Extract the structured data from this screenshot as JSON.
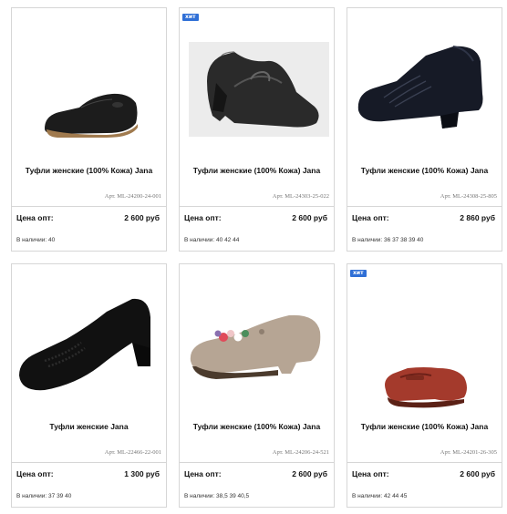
{
  "products": [
    {
      "badge": "",
      "name": "Туфли женские (100% Кожа) Jana",
      "sku": "Арт. ML-24200-24-001",
      "price_label": "Цена опт:",
      "price": "2 600 руб",
      "availability": "В наличии: 40",
      "image": "black-leather-loafer-icon"
    },
    {
      "badge": "хит",
      "name": "Туфли женские (100% Кожа) Jana",
      "sku": "Арт. ML-24303-25-022",
      "price_label": "Цена опт:",
      "price": "2 600 руб",
      "availability": "В наличии: 40 42 44",
      "image": "black-mary-jane-shoe-icon"
    },
    {
      "badge": "",
      "name": "Туфли женские (100% Кожа) Jana",
      "sku": "Арт. ML-24308-25-805",
      "price_label": "Цена опт:",
      "price": "2 860 руб",
      "availability": "В наличии: 36 37 38 39 40",
      "image": "navy-heeled-shoe-icon"
    },
    {
      "badge": "",
      "name": "Туфли женские Jana",
      "sku": "Арт. ML-22466-22-001",
      "price_label": "Цена опт:",
      "price": "1 300 руб",
      "availability": "В наличии: 37 39 40",
      "image": "black-suede-pump-icon"
    },
    {
      "badge": "",
      "name": "Туфли женские (100% Кожа) Jana",
      "sku": "Арт. ML-24206-24-521",
      "price_label": "Цена опт:",
      "price": "2 600 руб",
      "availability": "В наличии: 38,5 39 40,5",
      "image": "beige-suede-loafer-icon"
    },
    {
      "badge": "хит",
      "name": "Туфли женские (100% Кожа) Jana",
      "sku": "Арт. ML-24201-26-305",
      "price_label": "Цена опт:",
      "price": "2 600 руб",
      "availability": "В наличии: 42 44 45",
      "image": "brown-penny-loafer-icon"
    }
  ]
}
